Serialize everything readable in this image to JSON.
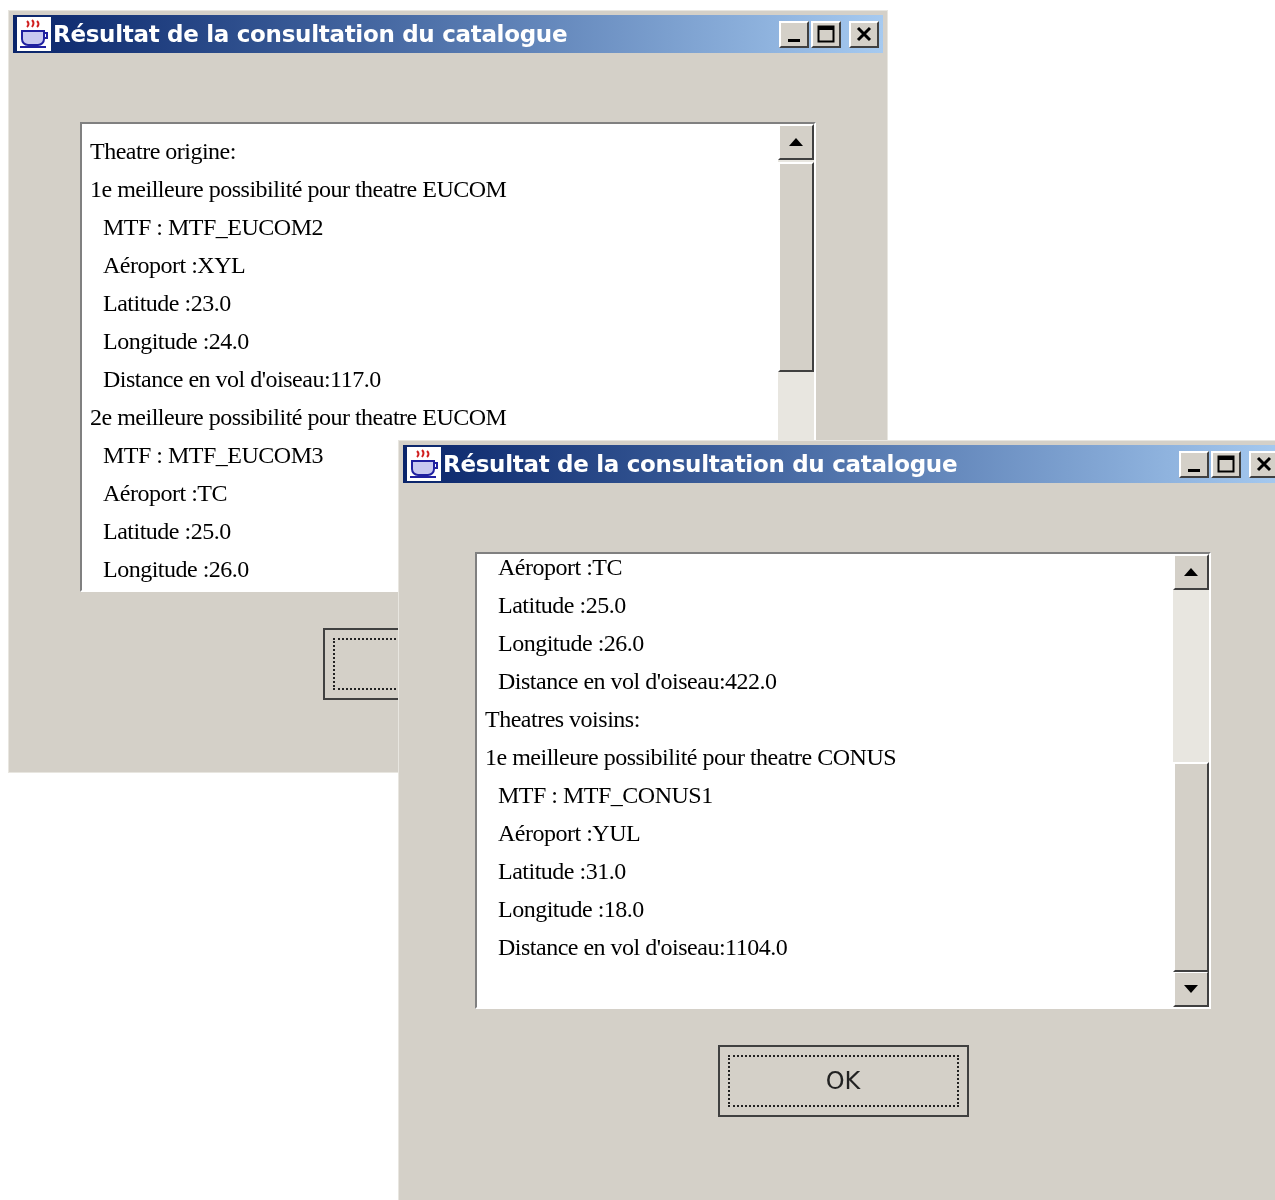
{
  "windows": [
    {
      "title": "Résultat de la consultation du catalogue",
      "active": true,
      "lines": [
        {
          "text": "Theatre origine:"
        },
        {
          "text": "1e meilleure possibilité pour theatre EUCOM",
          "children": [
            {
              "text": "MTF : MTF_EUCOM2"
            },
            {
              "text": "Aéroport :XYL"
            },
            {
              "text": "Latitude :23.0"
            },
            {
              "text": "Longitude :24.0"
            },
            {
              "text": "Distance en vol d'oiseau:117.0"
            }
          ]
        },
        {
          "text": "2e meilleure possibilité pour theatre EUCOM",
          "children": [
            {
              "text": "MTF : MTF_EUCOM3"
            },
            {
              "text": "Aéroport :TC"
            },
            {
              "text": "Latitude :25.0"
            },
            {
              "text": "Longitude :26.0"
            }
          ]
        }
      ],
      "button": {
        "focused": true
      }
    },
    {
      "title": "Résultat de la consultation du catalogue",
      "active": true,
      "lines": [
        {
          "children": [
            {
              "text": "Aéroport :TC"
            },
            {
              "text": "Latitude :25.0"
            },
            {
              "text": "Longitude :26.0"
            },
            {
              "text": "Distance en vol d'oiseau:422.0"
            }
          ]
        },
        {
          "text": "Theatres voisins:"
        },
        {
          "text": "1e meilleure possibilité pour theatre CONUS",
          "children": [
            {
              "text": "MTF : MTF_CONUS1"
            },
            {
              "text": "Aéroport :YUL"
            },
            {
              "text": "Latitude :31.0"
            },
            {
              "text": "Longitude :18.0"
            },
            {
              "text": "Distance en vol d'oiseau:1104.0"
            }
          ]
        }
      ],
      "button": {
        "label": "OK",
        "focused": true
      }
    }
  ]
}
